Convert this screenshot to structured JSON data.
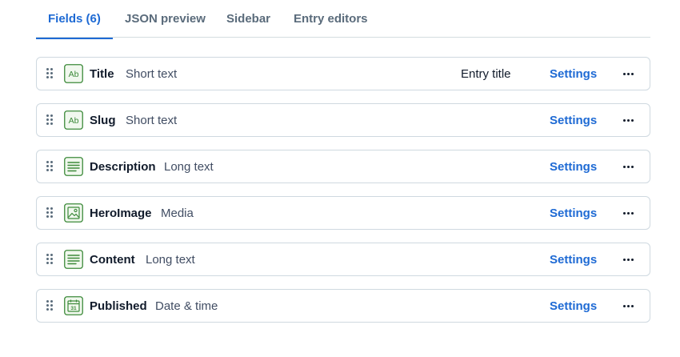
{
  "tabs": [
    {
      "label": "Fields (6)",
      "active": true
    },
    {
      "label": "JSON preview",
      "active": false
    },
    {
      "label": "Sidebar",
      "active": false
    },
    {
      "label": "Entry editors",
      "active": false
    }
  ],
  "fields": [
    {
      "name": "Title",
      "type": "Short text",
      "icon": "short-text-icon",
      "badge": "Entry title",
      "settings": "Settings"
    },
    {
      "name": "Slug",
      "type": "Short text",
      "icon": "short-text-icon",
      "badge": "",
      "settings": "Settings"
    },
    {
      "name": "Description",
      "type": "Long text",
      "icon": "long-text-icon",
      "badge": "",
      "settings": "Settings"
    },
    {
      "name": "HeroImage",
      "type": "Media",
      "icon": "media-icon",
      "badge": "",
      "settings": "Settings"
    },
    {
      "name": "Content",
      "type": "Long text",
      "icon": "long-text-icon",
      "badge": "",
      "settings": "Settings"
    },
    {
      "name": "Published",
      "type": "Date & time",
      "icon": "date-time-icon",
      "badge": "",
      "settings": "Settings"
    }
  ],
  "colors": {
    "accent": "#1e6ad4",
    "icon_green": "#3d8a3a",
    "border": "#cfd9e0"
  }
}
